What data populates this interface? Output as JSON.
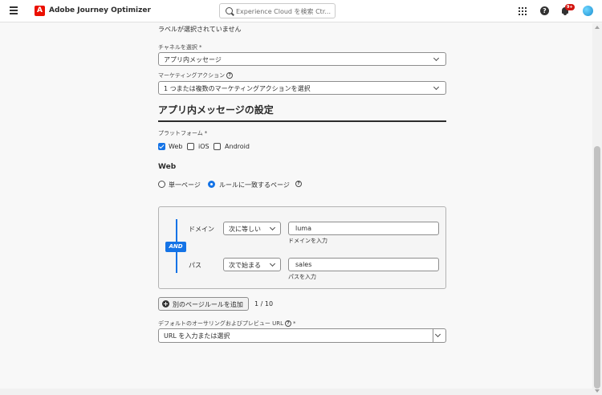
{
  "header": {
    "app_title": "Adobe Journey Optimizer",
    "logo_letter": "A",
    "search_placeholder": "Experience Cloud を検索 Ctr...",
    "notification_count": "9+"
  },
  "form": {
    "no_labels_text": "ラベルが選択されていません",
    "channel": {
      "label": "チャネルを選択",
      "required": "*",
      "value": "アプリ内メッセージ"
    },
    "marketing_action": {
      "label": "マーケティングアクション",
      "value": "1 つまたは複数のマーケティングアクションを選択"
    },
    "section_title": "アプリ内メッセージの設定",
    "platform": {
      "label": "プラットフォーム",
      "required": "*",
      "options": [
        {
          "label": "Web",
          "checked": true
        },
        {
          "label": "iOS",
          "checked": false
        },
        {
          "label": "Android",
          "checked": false
        }
      ]
    },
    "web": {
      "heading": "Web",
      "radio_options": [
        {
          "label": "単一ページ",
          "selected": false
        },
        {
          "label": "ルールに一致するページ",
          "selected": true
        }
      ]
    },
    "rules": {
      "operator_badge": "AND",
      "rows": [
        {
          "field": "ドメイン",
          "operator": "次に等しい",
          "value": "luma",
          "help": "ドメインを入力"
        },
        {
          "field": "パス",
          "operator": "次で始まる",
          "value": "sales",
          "help": "パスを入力"
        }
      ],
      "add_button": "別のページルールを追加",
      "count": "1 / 10"
    },
    "default_url": {
      "label": "デフォルトのオーサリングおよびプレビュー URL",
      "required": "*",
      "placeholder": "URL を入力または選択"
    }
  },
  "colors": {
    "accent": "#1473e6",
    "brand": "#eb1000",
    "badge": "#d31510"
  }
}
